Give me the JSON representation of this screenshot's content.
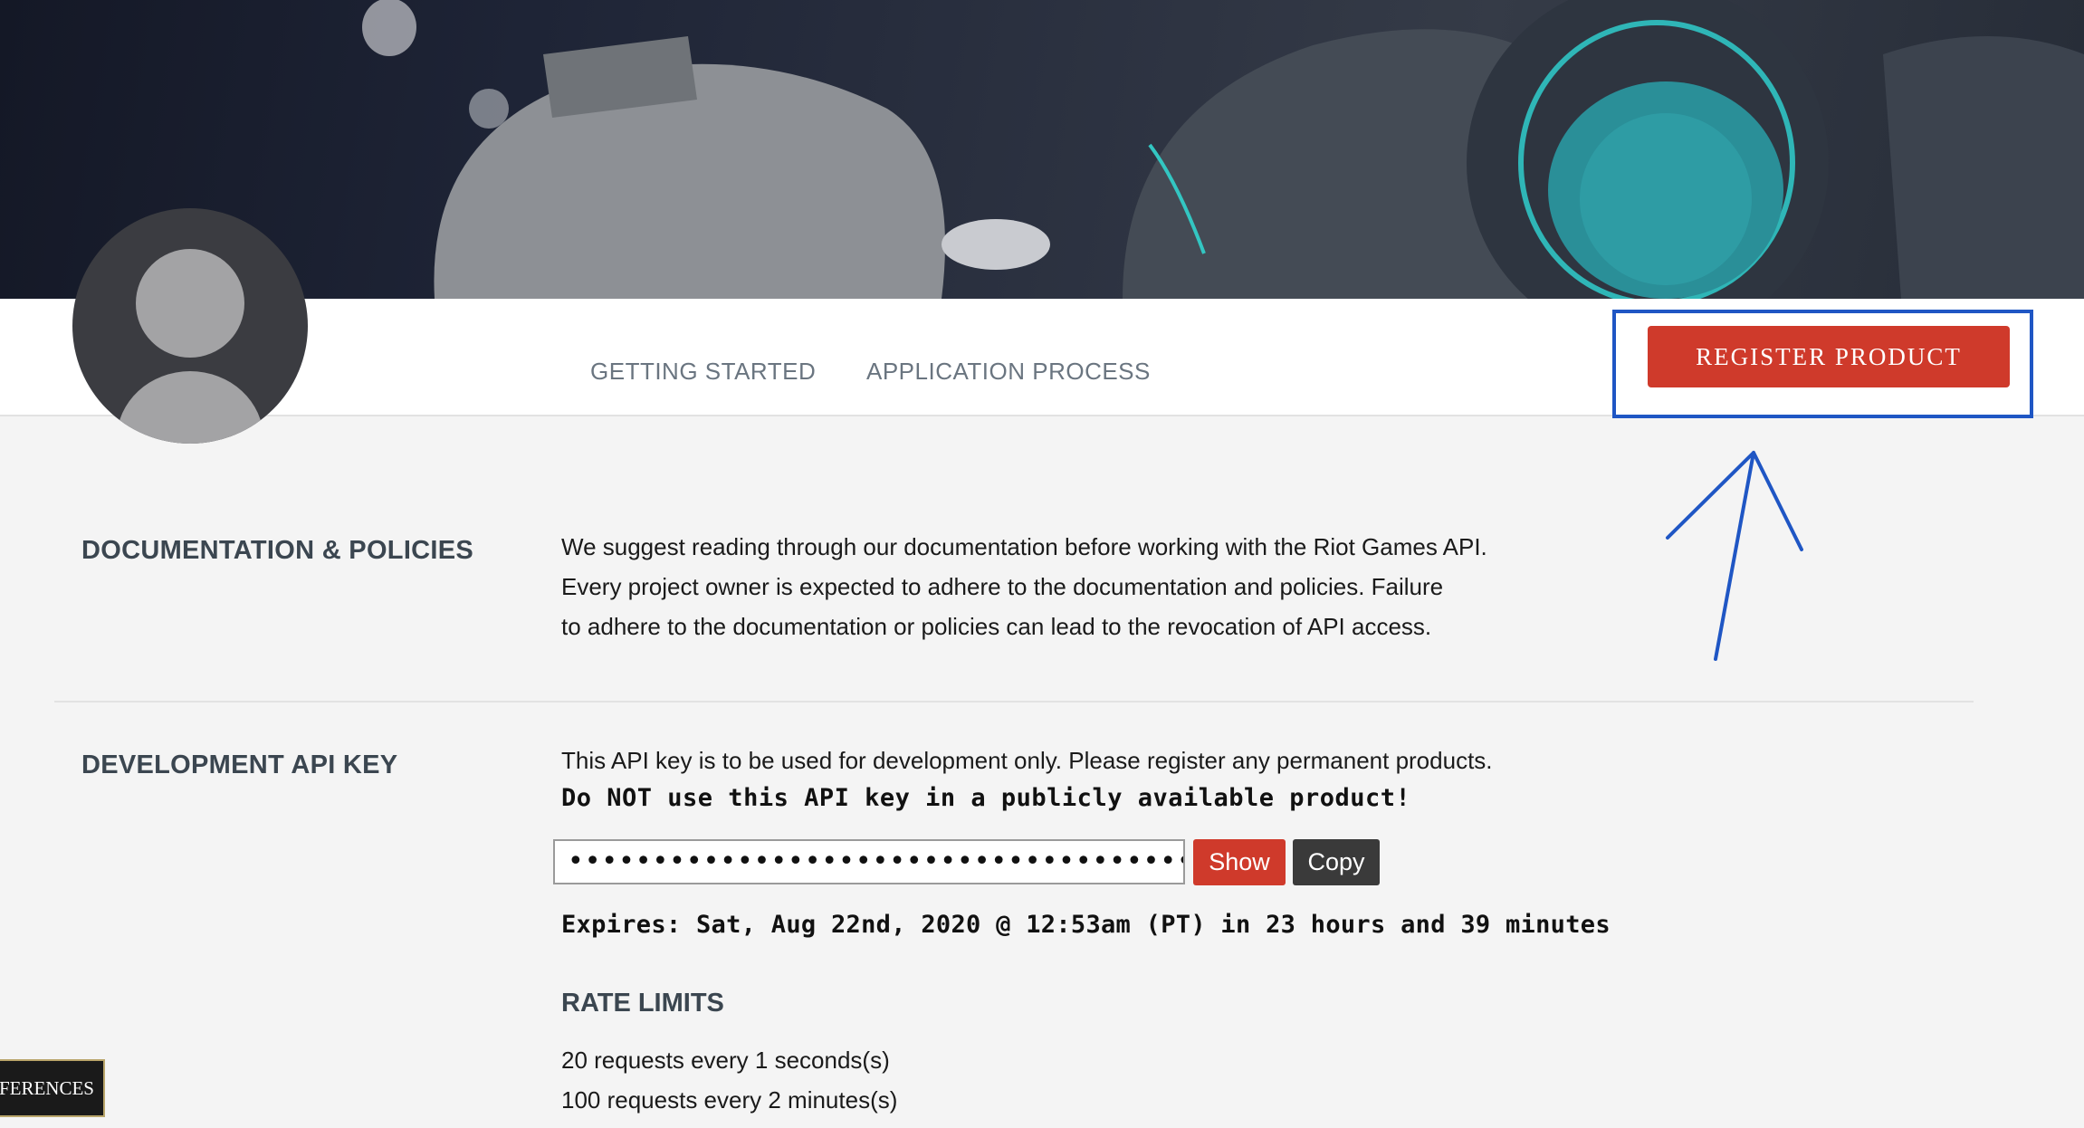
{
  "nav": {
    "tabs": [
      "GETTING STARTED",
      "APPLICATION PROCESS"
    ],
    "register_label": "REGISTER PRODUCT"
  },
  "docs": {
    "title": "DOCUMENTATION & POLICIES",
    "lines": [
      "We suggest reading through our documentation before working with the Riot Games API.",
      "Every project owner is expected to adhere to the documentation and policies. Failure",
      "to adhere to the documentation or policies can lead to the revocation of API access."
    ]
  },
  "dev_key": {
    "title": "DEVELOPMENT API KEY",
    "note": "This API key is to be used for development only. Please register any permanent products.",
    "warning": "Do NOT use this API key in a publicly available product!",
    "masked_value": "•••••••••••••••••••••••••••••••••••••••••••",
    "show_label": "Show",
    "copy_label": "Copy",
    "expires": "Expires: Sat, Aug 22nd, 2020 @ 12:53am (PT) in 23 hours and 39 minutes"
  },
  "rate_limits": {
    "title": "RATE LIMITS",
    "items": [
      "20 requests every 1 seconds(s)",
      "100 requests every 2 minutes(s)"
    ]
  },
  "prefs_label": "FERENCES",
  "colors": {
    "accent_red": "#cf3a2b",
    "annotation_blue": "#1f56c4"
  }
}
